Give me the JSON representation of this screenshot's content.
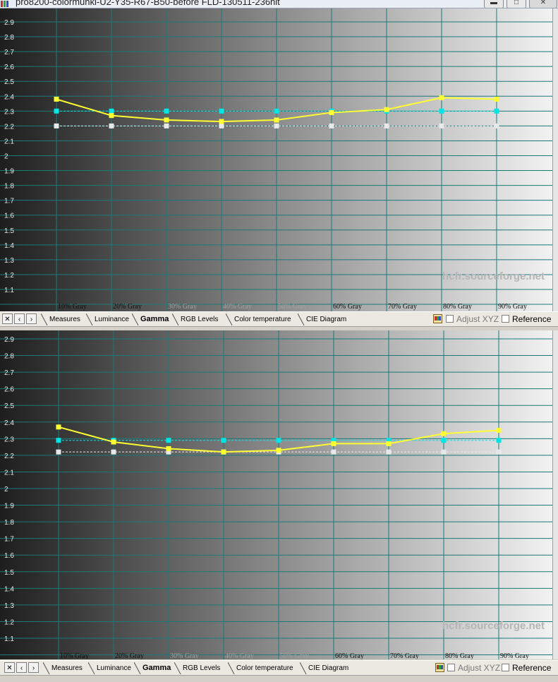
{
  "window": {
    "title": "pro8200-colormunki-U2-Y35-R67-B50-before FLD-130511-236nit"
  },
  "watermark": "hcfr.sourceforge.net",
  "tabs": {
    "items": [
      "Measures",
      "Luminance",
      "Gamma",
      "RGB Levels",
      "Color temperature",
      "CIE Diagram"
    ],
    "active": "Gamma"
  },
  "options": {
    "adjust_xyz": "Adjust XYZ",
    "reference": "Reference"
  },
  "colors": {
    "measured": "#ffff33",
    "reference": "#00e5e5",
    "target": "#e8e8e8",
    "grid": "#1a7a7a"
  },
  "chart_data": [
    {
      "type": "line",
      "x": [
        "10% Gray",
        "20% Gray",
        "30% Gray",
        "40% Gray",
        "50% Gray",
        "60% Gray",
        "70% Gray",
        "80% Gray",
        "90% Gray"
      ],
      "yticks": [
        "2.9",
        "2.8",
        "2.7",
        "2.6",
        "2.5",
        "2.4",
        "2.3",
        "2.2",
        "2.1",
        "2",
        "1.9",
        "1.8",
        "1.7",
        "1.6",
        "1.5",
        "1.4",
        "1.3",
        "1.2",
        "1.1"
      ],
      "ylim": [
        1.0,
        2.95
      ],
      "series": [
        {
          "values": [
            2.38,
            2.27,
            2.24,
            2.23,
            2.24,
            2.29,
            2.31,
            2.39,
            2.38
          ]
        },
        {
          "values": [
            2.3,
            2.3,
            2.3,
            2.3,
            2.3,
            2.3,
            2.3,
            2.3,
            2.3
          ]
        },
        {
          "values": [
            2.2,
            2.2,
            2.2,
            2.2,
            2.2,
            2.2,
            2.2,
            2.2,
            2.2
          ]
        }
      ]
    },
    {
      "type": "line",
      "x": [
        "10% Gray",
        "20% Gray",
        "30% Gray",
        "40% Gray",
        "50% Gray",
        "60% Gray",
        "70% Gray",
        "80% Gray",
        "90% Gray"
      ],
      "yticks": [
        "2.9",
        "2.8",
        "2.7",
        "2.6",
        "2.5",
        "2.4",
        "2.3",
        "2.2",
        "2.1",
        "2",
        "1.9",
        "1.8",
        "1.7",
        "1.6",
        "1.5",
        "1.4",
        "1.3",
        "1.2",
        "1.1"
      ],
      "ylim": [
        1.0,
        2.95
      ],
      "series": [
        {
          "values": [
            2.37,
            2.28,
            2.24,
            2.22,
            2.23,
            2.27,
            2.27,
            2.33,
            2.35
          ]
        },
        {
          "values": [
            2.29,
            2.29,
            2.29,
            2.29,
            2.29,
            2.29,
            2.29,
            2.29,
            2.29
          ]
        },
        {
          "values": [
            2.22,
            2.22,
            2.22,
            2.22,
            2.22,
            2.22,
            2.22,
            2.22,
            2.22
          ]
        }
      ]
    }
  ]
}
